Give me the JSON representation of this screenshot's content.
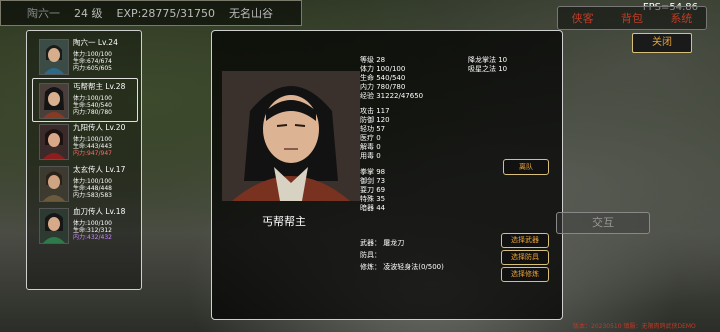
{
  "topbar": {
    "name": "陶六一",
    "level": "24 级",
    "exp": "EXP:28775/31750",
    "location": "无名山谷"
  },
  "fps": "FPS=54.86",
  "top_tabs": [
    "侠客",
    "背包",
    "系统"
  ],
  "close_label": "关闭",
  "roster": [
    {
      "name": "陶六一 Lv.24",
      "hp": "体力:100/100",
      "life": "生命:674/674",
      "mp": "内力:605/605",
      "mp_color": "white"
    },
    {
      "name": "丐帮帮主 Lv.28",
      "hp": "体力:100/100",
      "life": "生命:540/540",
      "mp": "内力:780/780",
      "mp_color": "white"
    },
    {
      "name": "九阳传人 Lv.20",
      "hp": "体力:100/100",
      "life": "生命:443/443",
      "mp": "内力:947/947",
      "mp_color": "red"
    },
    {
      "name": "太玄传人 Lv.17",
      "hp": "体力:100/100",
      "life": "生命:448/448",
      "mp": "内力:583/583",
      "mp_color": "white"
    },
    {
      "name": "血刀传人 Lv.18",
      "hp": "体力:100/100",
      "life": "生命:312/312",
      "mp": "内力:432/432",
      "mp_color": "purple"
    }
  ],
  "detail": {
    "name": "丐帮帮主",
    "stats": [
      "等级 28",
      "体力 100/100",
      "生命 540/540",
      "内力 780/780",
      "经验 31222/47650"
    ],
    "skills": [
      "降龙掌法 10",
      "吸星之法 10"
    ],
    "combat": [
      "攻击 117",
      "防御 120",
      "轻功 57",
      "医疗 0",
      "解毒 0",
      "用毒 0"
    ],
    "weapons": [
      "拳掌 98",
      "御剑 73",
      "耍刀 69",
      "特殊 35",
      "暗器 44"
    ],
    "weapon": "武器：  屠龙刀",
    "armor": "防具：",
    "training": "修炼：  凌波轻身法(0/500)",
    "leave_label": "离队",
    "btn_weapon": "选择武器",
    "btn_armor": "选择防具",
    "btn_train": "选择修炼"
  },
  "interact_label": "交互",
  "footer": "版本：20230510 镇服：无限肉鸽武侠DEMO"
}
